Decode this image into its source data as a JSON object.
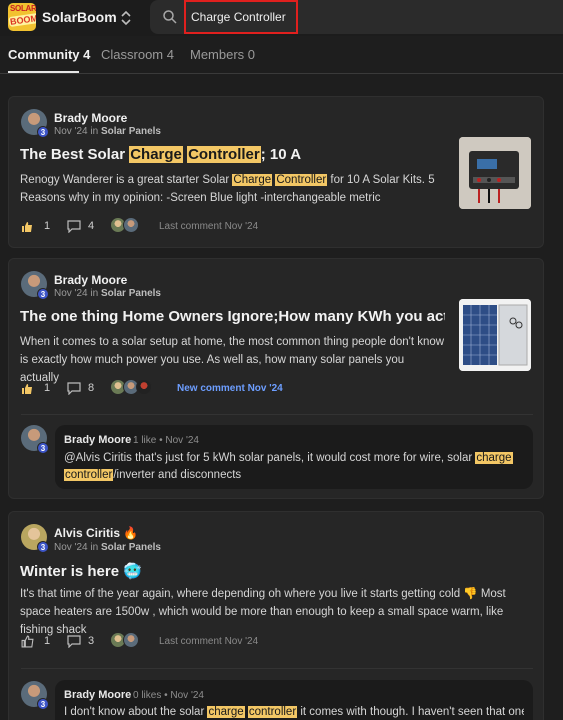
{
  "app": {
    "name": "SolarBoom",
    "logo_text_top": "SOLAR",
    "logo_text_bottom": "BOOM"
  },
  "search": {
    "value": "Charge Controller",
    "placeholder": "Search"
  },
  "tabs": [
    {
      "label": "Community 4",
      "active": true
    },
    {
      "label": "Classroom 4",
      "active": false
    },
    {
      "label": "Members 0",
      "active": false
    }
  ],
  "posts": [
    {
      "author": "Brady Moore",
      "level": "3",
      "meta_date": "Nov '24 in",
      "meta_category": "Solar Panels",
      "title_pre": "The Best Solar ",
      "title_hl1": "Charge",
      "title_mid": " ",
      "title_hl2": "Controller",
      "title_post": "; 10 A",
      "body_pre": "Renogy Wanderer is a great starter Solar ",
      "body_hl1": "Charge",
      "body_mid": " ",
      "body_hl2": "Controller",
      "body_post": " for 10 A Solar Kits. 5 Reasons why in my opinion: -Screen Blue light -interchangeable metric",
      "likes": "1",
      "comments": "4",
      "last_comment": "Last comment Nov '24",
      "thumb_icon": "charge-controller-photo"
    },
    {
      "author": "Brady Moore",
      "level": "3",
      "meta_date": "Nov '24 in",
      "meta_category": "Solar Panels",
      "title": "The one thing Home Owners Ignore;How many KWh you actually ...",
      "body": "When it comes to a solar setup at home, the most common thing people don't know is exactly how much power you use. As well as, how many solar panels you actually",
      "likes": "1",
      "comments": "8",
      "new_comment": "New comment Nov '24",
      "thumb_icon": "solar-panel-photo",
      "reply": {
        "author": "Brady Moore",
        "meta": "1 like • Nov '24",
        "text_pre": "@Alvis Ciritis that's just for 5 kWh solar panels, it would cost more for wire, solar ",
        "hl1": "charge",
        "mid": " ",
        "hl2": "controller",
        "text_post": "/inverter and disconnects"
      }
    },
    {
      "author": "Alvis Ciritis",
      "author_emoji": "🔥",
      "level": "3",
      "meta_date": "Nov '24 in",
      "meta_category": "Solar Panels",
      "title": "Winter is here",
      "title_emoji": "🥶",
      "body_pre": "It's that time of the year again, where depending oh where you live it starts getting cold ",
      "body_emoji": "👎",
      "body_post": " Most space heaters are 1500w , which would be more than enough to keep a small space warm, like fishing shack",
      "likes": "1",
      "comments": "3",
      "last_comment": "Last comment Nov '24",
      "reply": {
        "author": "Brady Moore",
        "meta": "0 likes • Nov '24",
        "text_pre": "I don't know about the solar ",
        "hl1": "charge",
        "mid": " ",
        "hl2": "controller",
        "text_post": " it comes with though. I haven't seen that one"
      }
    }
  ],
  "colors": {
    "highlight": "#f3c765",
    "accent_blue": "#6d9eff",
    "badge_blue": "#3d55c7",
    "search_outline": "#e0201e"
  }
}
